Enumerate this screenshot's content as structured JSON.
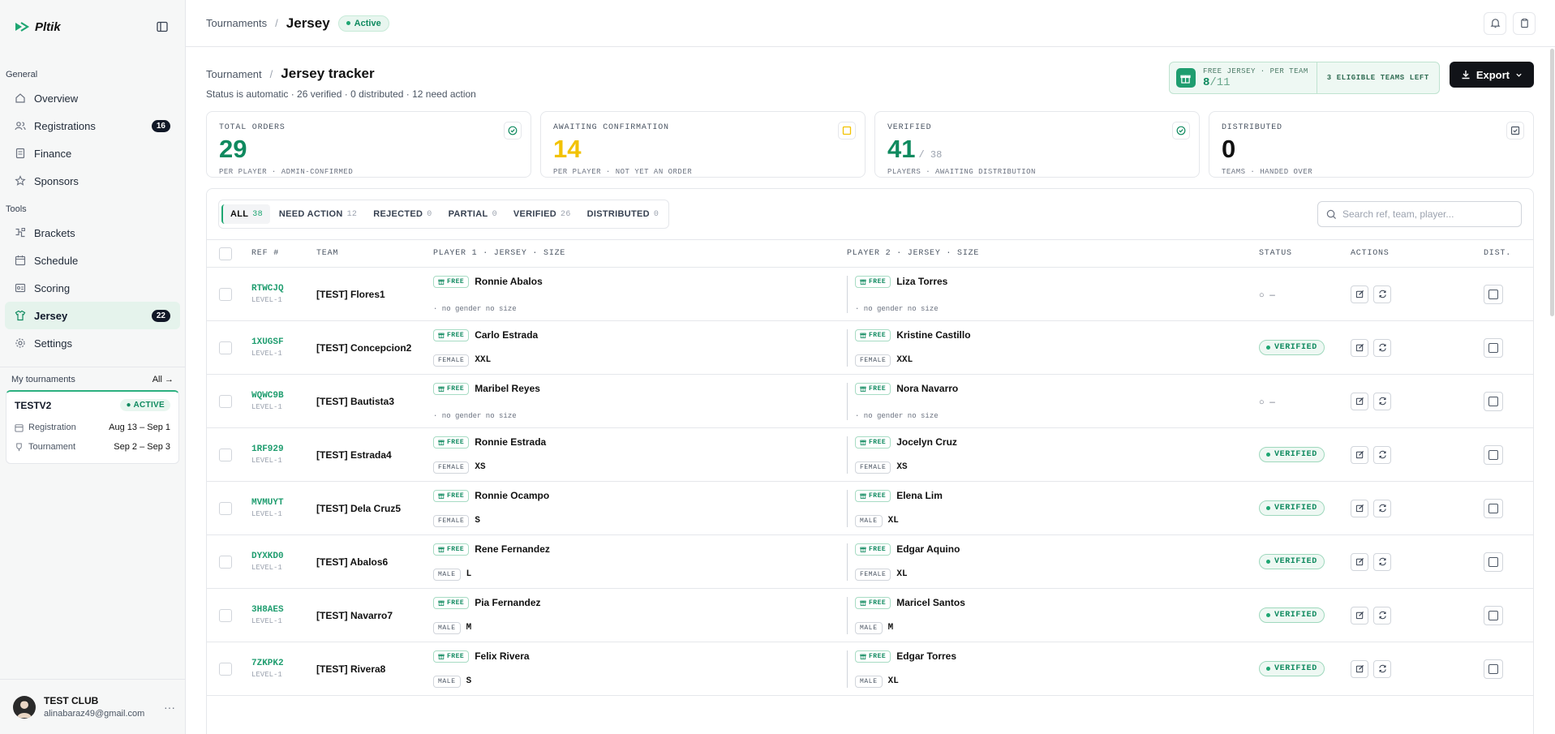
{
  "app": {
    "logo_text": "Pltik"
  },
  "sidebar": {
    "general_label": "General",
    "tools_label": "Tools",
    "general_items": [
      {
        "label": "Overview",
        "icon": "home-icon"
      },
      {
        "label": "Registrations",
        "icon": "users-icon",
        "count": "16"
      },
      {
        "label": "Finance",
        "icon": "receipt-icon"
      },
      {
        "label": "Sponsors",
        "icon": "star-icon"
      }
    ],
    "tools_items": [
      {
        "label": "Brackets",
        "icon": "bracket-icon"
      },
      {
        "label": "Schedule",
        "icon": "calendar-icon"
      },
      {
        "label": "Scoring",
        "icon": "scoreboard-icon"
      },
      {
        "label": "Jersey",
        "icon": "shirt-icon",
        "count": "22",
        "active": true
      },
      {
        "label": "Settings",
        "icon": "gear-icon"
      }
    ],
    "my_tournaments_label": "My tournaments",
    "all_link": "All →",
    "tournament": {
      "name": "TESTV2",
      "badge": "ACTIVE",
      "registration_label": "Registration",
      "registration_dates": "Aug 13 – Sep 1",
      "tournament_label": "Tournament",
      "tournament_dates": "Sep 2 – Sep 3"
    },
    "user": {
      "name": "TEST CLUB",
      "email": "alinabaraz49@gmail.com",
      "more": "···"
    }
  },
  "topbar": {
    "breadcrumb_root": "Tournaments",
    "breadcrumb_sep": "/",
    "current": "Jersey",
    "status": "Active"
  },
  "header": {
    "crumb": "Tournament",
    "sep": "/",
    "title": "Jersey tracker",
    "subtitle": "Status is automatic · 26 verified · 0 distributed · 12 need action",
    "promo_label": "FREE JERSEY · PER TEAM",
    "promo_value": "8",
    "promo_total": "/11",
    "promo_right": "3 ELIGIBLE TEAMS LEFT",
    "export_label": "Export"
  },
  "stats": [
    {
      "label": "TOTAL ORDERS",
      "value": "29",
      "of": "",
      "sub": "PER PLAYER · ADMIN-CONFIRMED",
      "color": "#0f8a5f",
      "icon": "check-circle-icon"
    },
    {
      "label": "AWAITING CONFIRMATION",
      "value": "14",
      "of": "",
      "sub": "PER PLAYER · NOT YET AN ORDER",
      "color": "#f2c200",
      "icon": "square-icon"
    },
    {
      "label": "VERIFIED",
      "value": "41",
      "of": "/ 38",
      "sub": "PLAYERS · AWAITING DISTRIBUTION",
      "color": "#0f8a5f",
      "icon": "check-circle-icon"
    },
    {
      "label": "DISTRIBUTED",
      "value": "0",
      "of": "",
      "sub": "TEAMS · HANDED OVER",
      "color": "#111111",
      "icon": "check-square-icon"
    }
  ],
  "filters": {
    "tabs": [
      {
        "label": "ALL",
        "count": "38"
      },
      {
        "label": "NEED ACTION",
        "count": "12"
      },
      {
        "label": "REJECTED",
        "count": "0"
      },
      {
        "label": "PARTIAL",
        "count": "0"
      },
      {
        "label": "VERIFIED",
        "count": "26"
      },
      {
        "label": "DISTRIBUTED",
        "count": "0"
      }
    ],
    "search_placeholder": "Search ref, team, player..."
  },
  "table": {
    "headers": {
      "ref": "REF #",
      "team": "TEAM",
      "p1": "PLAYER 1 · JERSEY · SIZE",
      "p2": "PLAYER 2 · JERSEY · SIZE",
      "status": "STATUS",
      "actions": "ACTIONS",
      "dist": "DIST."
    },
    "free_label": "FREE",
    "rows": [
      {
        "ref": "RTWCJQ",
        "level": "LEVEL-1",
        "team": "[TEST] Flores1",
        "p1": {
          "name": "Ronnie Abalos",
          "gender": "",
          "size": "",
          "nosize": "· no gender no size"
        },
        "p2": {
          "name": "Liza Torres",
          "gender": "",
          "size": "",
          "nosize": "· no gender no size"
        },
        "status": "○ —",
        "verified": false
      },
      {
        "ref": "1XUGSF",
        "level": "LEVEL-1",
        "team": "[TEST] Concepcion2",
        "p1": {
          "name": "Carlo Estrada",
          "gender": "FEMALE",
          "size": "XXL",
          "nosize": ""
        },
        "p2": {
          "name": "Kristine Castillo",
          "gender": "FEMALE",
          "size": "XXL",
          "nosize": ""
        },
        "status": "VERIFIED",
        "verified": true
      },
      {
        "ref": "WQWC9B",
        "level": "LEVEL-1",
        "team": "[TEST] Bautista3",
        "p1": {
          "name": "Maribel Reyes",
          "gender": "",
          "size": "",
          "nosize": "· no gender no size"
        },
        "p2": {
          "name": "Nora Navarro",
          "gender": "",
          "size": "",
          "nosize": "· no gender no size"
        },
        "status": "○ —",
        "verified": false
      },
      {
        "ref": "1RF929",
        "level": "LEVEL-1",
        "team": "[TEST] Estrada4",
        "p1": {
          "name": "Ronnie Estrada",
          "gender": "FEMALE",
          "size": "XS",
          "nosize": ""
        },
        "p2": {
          "name": "Jocelyn Cruz",
          "gender": "FEMALE",
          "size": "XS",
          "nosize": ""
        },
        "status": "VERIFIED",
        "verified": true
      },
      {
        "ref": "MVMUYT",
        "level": "LEVEL-1",
        "team": "[TEST] Dela Cruz5",
        "p1": {
          "name": "Ronnie Ocampo",
          "gender": "FEMALE",
          "size": "S",
          "nosize": ""
        },
        "p2": {
          "name": "Elena Lim",
          "gender": "MALE",
          "size": "XL",
          "nosize": ""
        },
        "status": "VERIFIED",
        "verified": true
      },
      {
        "ref": "DYXKD0",
        "level": "LEVEL-1",
        "team": "[TEST] Abalos6",
        "p1": {
          "name": "Rene Fernandez",
          "gender": "MALE",
          "size": "L",
          "nosize": ""
        },
        "p2": {
          "name": "Edgar Aquino",
          "gender": "FEMALE",
          "size": "XL",
          "nosize": ""
        },
        "status": "VERIFIED",
        "verified": true
      },
      {
        "ref": "3H8AES",
        "level": "LEVEL-1",
        "team": "[TEST] Navarro7",
        "p1": {
          "name": "Pia Fernandez",
          "gender": "MALE",
          "size": "M",
          "nosize": ""
        },
        "p2": {
          "name": "Maricel Santos",
          "gender": "MALE",
          "size": "M",
          "nosize": ""
        },
        "status": "VERIFIED",
        "verified": true
      },
      {
        "ref": "7ZKPK2",
        "level": "LEVEL-1",
        "team": "[TEST] Rivera8",
        "p1": {
          "name": "Felix Rivera",
          "gender": "MALE",
          "size": "S",
          "nosize": ""
        },
        "p2": {
          "name": "Edgar Torres",
          "gender": "MALE",
          "size": "XL",
          "nosize": ""
        },
        "status": "VERIFIED",
        "verified": true
      }
    ]
  }
}
